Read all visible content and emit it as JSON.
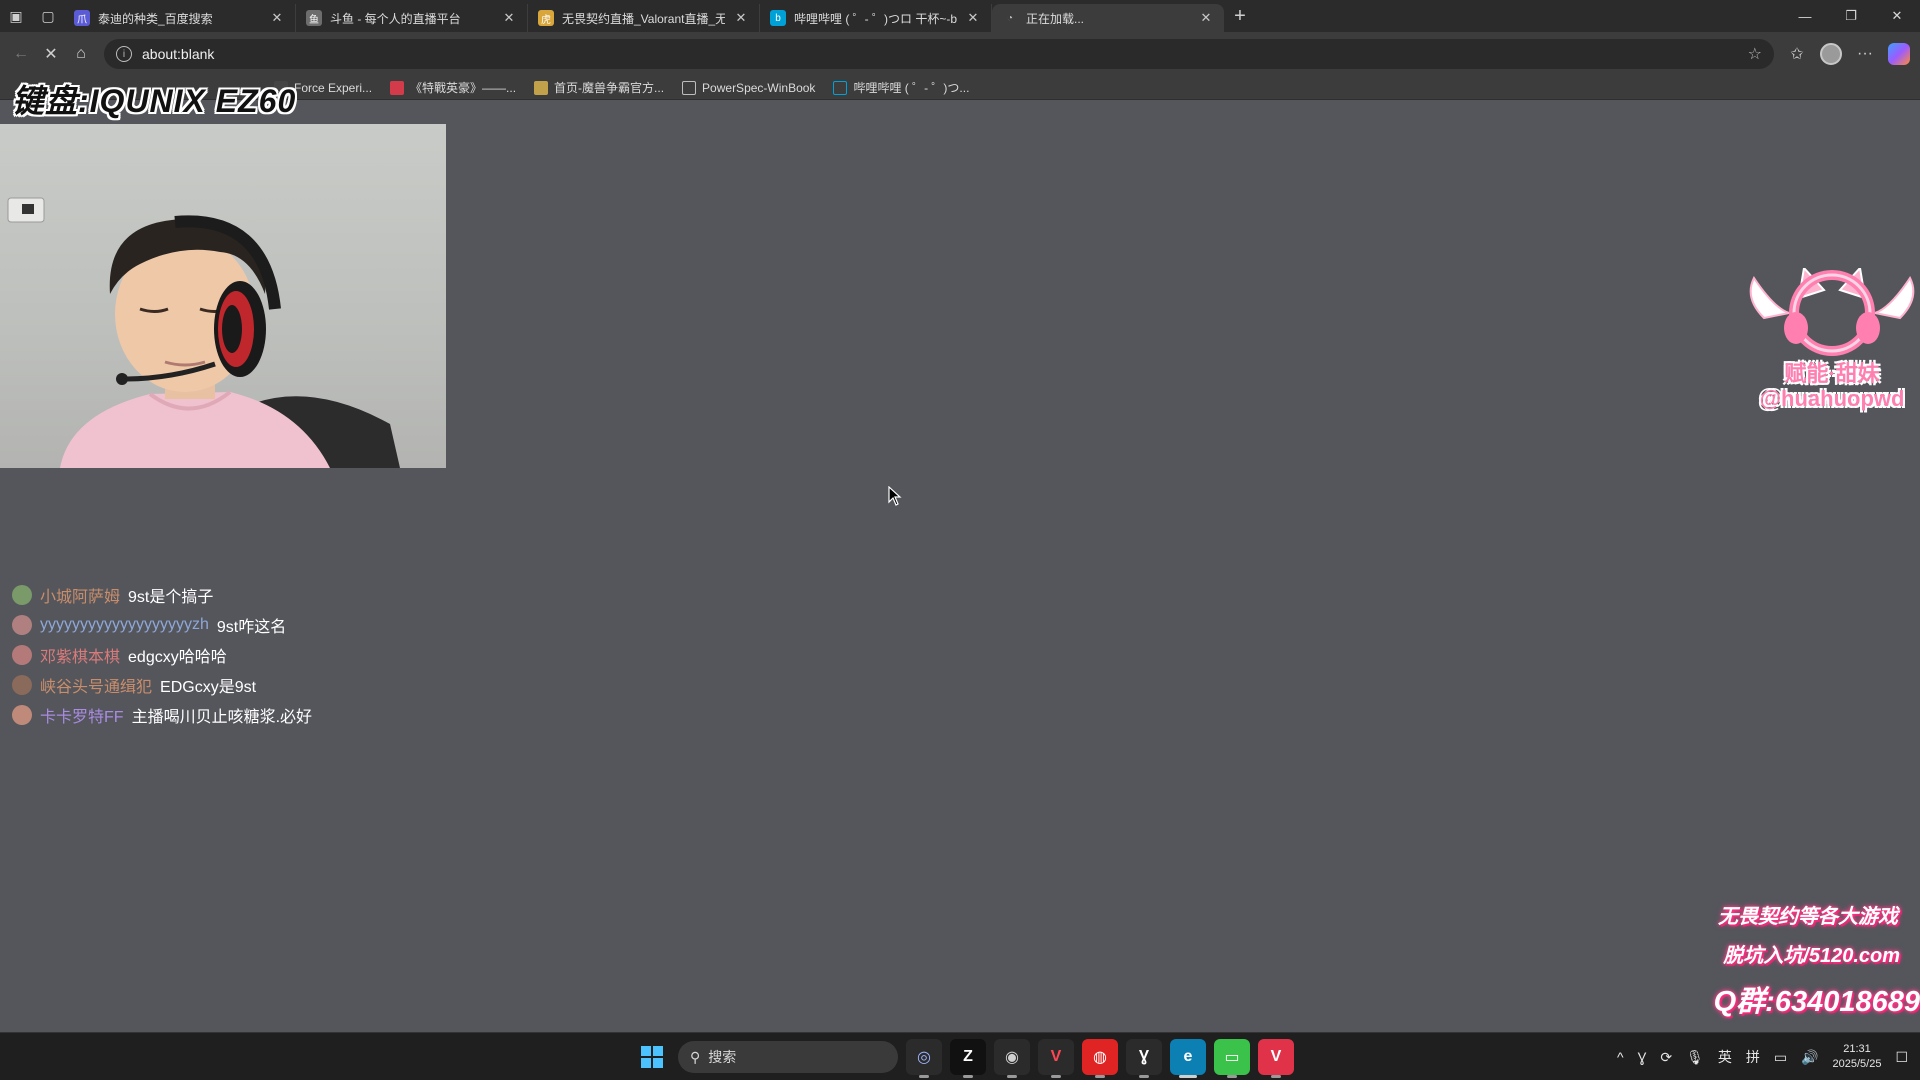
{
  "browser": {
    "tabs": [
      {
        "title": "泰迪的种类_百度搜索",
        "favicon_color": "#5b5bd6",
        "active": false
      },
      {
        "title": "斗鱼 - 每个人的直播平台",
        "favicon_color": "#6d6d6d",
        "active": false
      },
      {
        "title": "无畏契约直播_Valorant直播_无畏",
        "favicon_color": "#e0e0e0",
        "active": false
      },
      {
        "title": "哔哩哔哩 ( ゜- ゜)つロ 干杯~-bilib",
        "favicon_color": "#00a1d6",
        "active": false
      },
      {
        "title": "正在加载...",
        "favicon_color": "#bbbbbb",
        "active": true
      }
    ],
    "address": "about:blank",
    "bookmarks": [
      {
        "label": "Force Experi...",
        "color": "#444444"
      },
      {
        "label": "《特戰英豪》——...",
        "color": "#d43b4a"
      },
      {
        "label": "首页-魔兽争霸官方...",
        "color": "#c2a14b"
      },
      {
        "label": "PowerSpec-WinBook",
        "color": "#8a8a8a"
      },
      {
        "label": "哔哩哔哩 ( ゜- ゜)つ...",
        "color": "#00a1d6"
      }
    ]
  },
  "overlay": {
    "keyboard_label": "键盘:IQUNIX EZ60",
    "logo_text_1": "赋能·甜妹",
    "logo_text_2": "@huahuopwd",
    "promo": {
      "line1": "无畏契约等各大游戏",
      "line2": "脱坑入坑/5120.com",
      "line3": "Q群:634018689"
    }
  },
  "chat": [
    {
      "user": "小城阿萨姆",
      "message": "9st是个搞子",
      "avatar_color": "#7a9a6a"
    },
    {
      "user": "yyyyyyyyyyyyyyyyyyyzh",
      "message": "9st咋这名",
      "avatar_color": "#b08080"
    },
    {
      "user": "邓紫棋本棋",
      "message": "edgcxy哈哈哈",
      "avatar_color": "#b47a7a"
    },
    {
      "user": "峡谷头号通缉犯",
      "message": "EDGcxy是9st",
      "avatar_color": "#8a6a5a"
    },
    {
      "user": "卡卡罗特FF",
      "message": "主播喝川贝止咳糖浆.必好",
      "avatar_color": "#c08a7a"
    }
  ],
  "taskbar": {
    "search_placeholder": "搜索",
    "apps": [
      {
        "name": "app-1-icon",
        "glyph": "◎",
        "bg": "#2b2b2b",
        "fg": "#9fb6ff"
      },
      {
        "name": "zed-icon",
        "glyph": "Z",
        "bg": "#111111",
        "fg": "#ffffff"
      },
      {
        "name": "obs-icon",
        "glyph": "◉",
        "bg": "#2b2b2b",
        "fg": "#cfcfcf"
      },
      {
        "name": "valorant-icon",
        "glyph": "V",
        "bg": "#2b2b2b",
        "fg": "#ff4655"
      },
      {
        "name": "netease-music-icon",
        "glyph": "◍",
        "bg": "#e02424",
        "fg": "#ffffff"
      },
      {
        "name": "app-6-icon",
        "glyph": "Ɣ",
        "bg": "#2b2b2b",
        "fg": "#ffffff"
      },
      {
        "name": "edge-icon",
        "glyph": "e",
        "bg": "#0c7fb3",
        "fg": "#ffffff"
      },
      {
        "name": "app-8-icon",
        "glyph": "▭",
        "bg": "#3ac24a",
        "fg": "#ffffff"
      },
      {
        "name": "app-9-icon",
        "glyph": "V",
        "bg": "#e0334a",
        "fg": "#ffffff"
      }
    ],
    "tray": {
      "lang": "英",
      "ime": "拼",
      "time": "21:31",
      "date": "2025/5/25"
    }
  }
}
